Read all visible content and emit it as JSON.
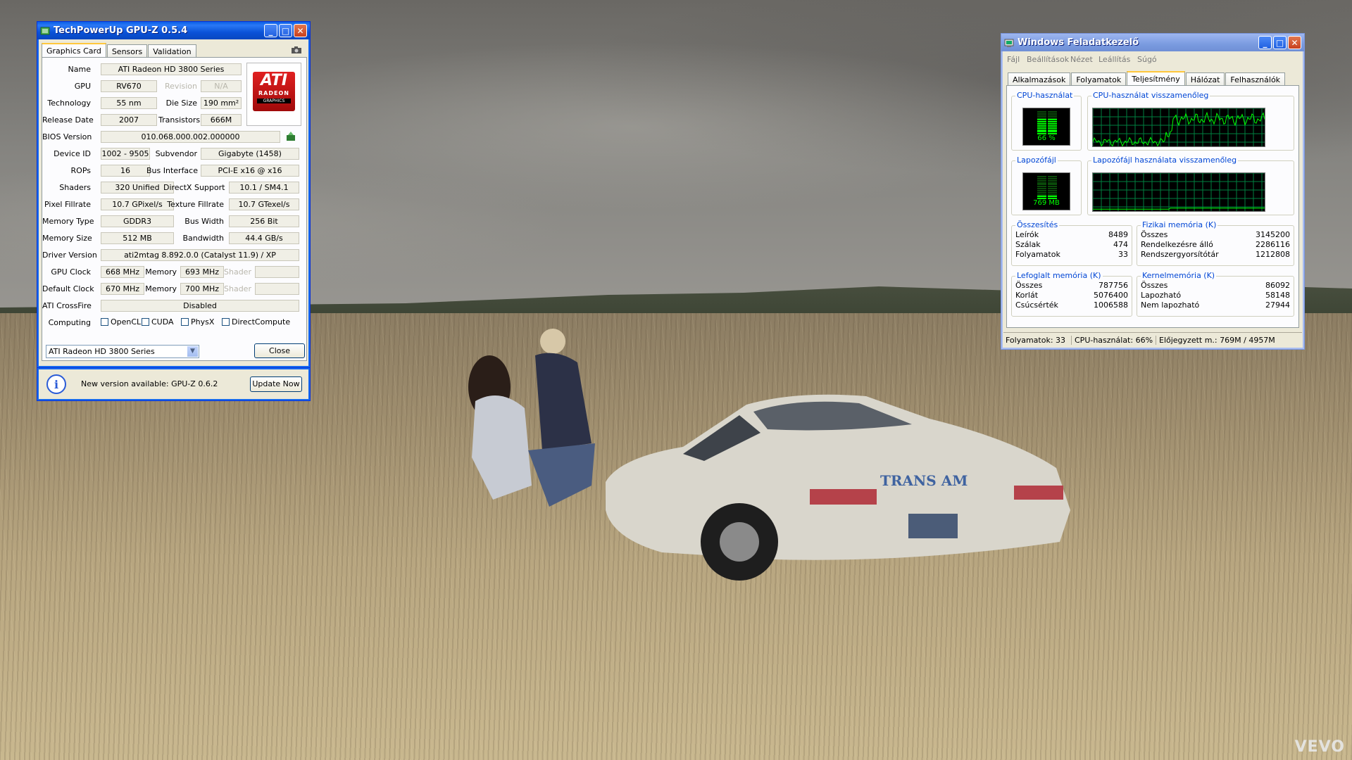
{
  "desktop": {
    "watermark": "VEVO",
    "car_label": "TRANS AM"
  },
  "gpuz": {
    "title": "TechPowerUp GPU-Z 0.5.4",
    "tabs": [
      "Graphics Card",
      "Sensors",
      "Validation"
    ],
    "fields": {
      "name_label": "Name",
      "name": "ATI Radeon HD 3800 Series",
      "gpu_label": "GPU",
      "gpu": "RV670",
      "revision_label": "Revision",
      "revision": "N/A",
      "technology_label": "Technology",
      "technology": "55 nm",
      "die_size_label": "Die Size",
      "die_size": "190 mm²",
      "release_date_label": "Release Date",
      "release_date": "2007",
      "transistors_label": "Transistors",
      "transistors": "666M",
      "bios_label": "BIOS Version",
      "bios": "010.068.000.002.000000",
      "device_id_label": "Device ID",
      "device_id": "1002 - 9505",
      "subvendor_label": "Subvendor",
      "subvendor": "Gigabyte (1458)",
      "rops_label": "ROPs",
      "rops": "16",
      "bus_interface_label": "Bus Interface",
      "bus_interface": "PCI-E x16 @ x16",
      "shaders_label": "Shaders",
      "shaders": "320 Unified",
      "directx_label": "DirectX Support",
      "directx": "10.1 / SM4.1",
      "pixel_fillrate_label": "Pixel Fillrate",
      "pixel_fillrate": "10.7 GPixel/s",
      "texture_fillrate_label": "Texture Fillrate",
      "texture_fillrate": "10.7 GTexel/s",
      "memory_type_label": "Memory Type",
      "memory_type": "GDDR3",
      "bus_width_label": "Bus Width",
      "bus_width": "256 Bit",
      "memory_size_label": "Memory Size",
      "memory_size": "512 MB",
      "bandwidth_label": "Bandwidth",
      "bandwidth": "44.4 GB/s",
      "driver_label": "Driver Version",
      "driver": "ati2mtag 8.892.0.0 (Catalyst 11.9) / XP",
      "gpu_clock_label": "GPU Clock",
      "gpu_clock": "668 MHz",
      "memory_label": "Memory",
      "gpu_memory_clock": "693 MHz",
      "shader_label": "Shader",
      "default_clock_label": "Default Clock",
      "default_clock": "670 MHz",
      "default_memory_clock": "700 MHz",
      "crossfire_label": "ATI CrossFire",
      "crossfire": "Disabled",
      "computing_label": "Computing"
    },
    "computing": [
      "OpenCL",
      "CUDA",
      "PhysX",
      "DirectCompute"
    ],
    "logo": {
      "brand": "ATI",
      "line1": "RADEON",
      "line2": "GRAPHICS"
    },
    "device_select": "ATI Radeon HD 3800 Series",
    "close_label": "Close",
    "update": {
      "message": "New version available: GPU-Z 0.6.2",
      "button": "Update Now"
    }
  },
  "taskman": {
    "title": "Windows Feladatkezelő",
    "menu": [
      "Fájl",
      "Beállítások",
      "Nézet",
      "Leállítás",
      "Súgó"
    ],
    "tabs": [
      "Alkalmazások",
      "Folyamatok",
      "Teljesítmény",
      "Hálózat",
      "Felhasználók"
    ],
    "cpu_usage": {
      "title": "CPU-használat",
      "value": "66 %",
      "level": 0.66
    },
    "cpu_history_title": "CPU-használat visszamenőleg",
    "pagefile": {
      "title": "Lapozófájl",
      "value": "769 MB",
      "level": 0.18
    },
    "pagefile_history_title": "Lapozófájl használata visszamenőleg",
    "totals": {
      "title": "Összesítés",
      "rows": [
        {
          "k": "Leírók",
          "v": "8489"
        },
        {
          "k": "Szálak",
          "v": "474"
        },
        {
          "k": "Folyamatok",
          "v": "33"
        }
      ]
    },
    "physical": {
      "title": "Fizikai memória (K)",
      "rows": [
        {
          "k": "Összes",
          "v": "3145200"
        },
        {
          "k": "Rendelkezésre álló",
          "v": "2286116"
        },
        {
          "k": "Rendszergyorsítótár",
          "v": "1212808"
        }
      ]
    },
    "commit": {
      "title": "Lefoglalt memória (K)",
      "rows": [
        {
          "k": "Összes",
          "v": "787756"
        },
        {
          "k": "Korlát",
          "v": "5076400"
        },
        {
          "k": "Csúcsérték",
          "v": "1006588"
        }
      ]
    },
    "kernel": {
      "title": "Kernelmemória (K)",
      "rows": [
        {
          "k": "Összes",
          "v": "86092"
        },
        {
          "k": "Lapozható",
          "v": "58148"
        },
        {
          "k": "Nem lapozható",
          "v": "27944"
        }
      ]
    },
    "status": {
      "processes": "Folyamatok: 33",
      "cpu": "CPU-használat: 66%",
      "commit": "Előjegyzett m.: 769M / 4957M"
    }
  }
}
